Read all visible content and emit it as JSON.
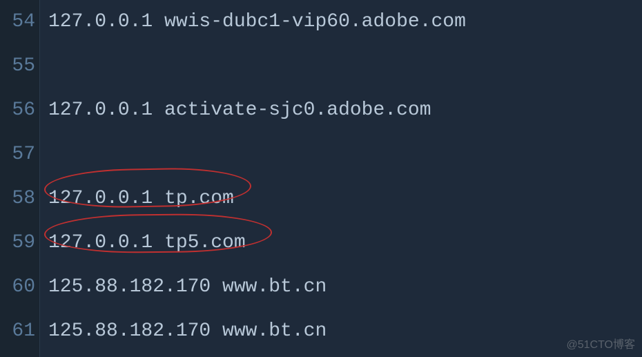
{
  "lines": [
    {
      "num": "54",
      "text": "127.0.0.1 wwis-dubc1-vip60.adobe.com"
    },
    {
      "num": "55",
      "text": ""
    },
    {
      "num": "56",
      "text": "127.0.0.1 activate-sjc0.adobe.com"
    },
    {
      "num": "57",
      "text": ""
    },
    {
      "num": "58",
      "text": "127.0.0.1 tp.com"
    },
    {
      "num": "59",
      "text": "127.0.0.1 tp5.com"
    },
    {
      "num": "60",
      "text": "125.88.182.170 www.bt.cn"
    },
    {
      "num": "61",
      "text": "125.88.182.170 www.bt.cn"
    }
  ],
  "watermark": "@51CTO博客"
}
